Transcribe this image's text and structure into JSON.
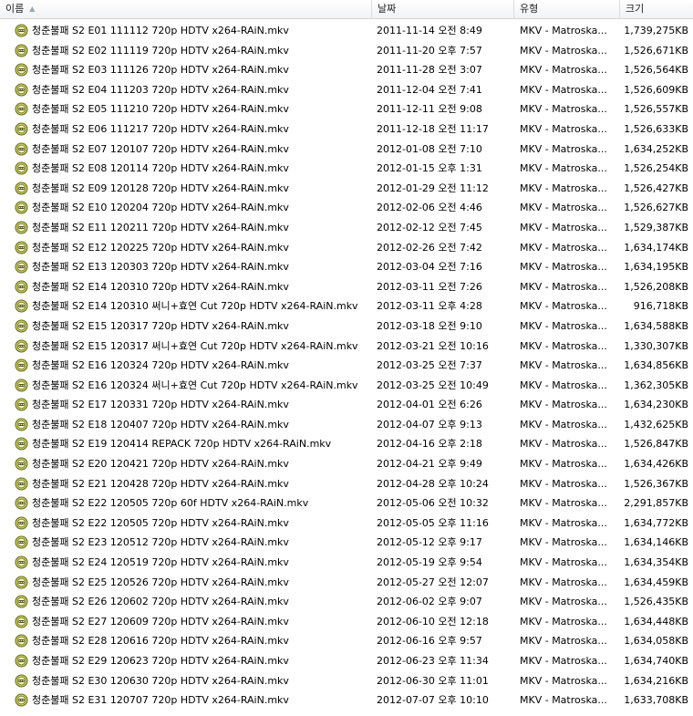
{
  "columns": {
    "name": "이름",
    "date": "날짜",
    "type": "유형",
    "size": "크기"
  },
  "sort": {
    "column": "name",
    "icon": "sort-ascending-icon"
  },
  "file_icon": "mkv-video-file-icon",
  "files": [
    {
      "name": "청춘불패 S2 E01 111112 720p HDTV x264-RAiN.mkv",
      "date": "2011-11-14 오전 8:49",
      "type": "MKV - Matroska...",
      "size": "1,739,275KB"
    },
    {
      "name": "청춘불패 S2 E02 111119 720p HDTV x264-RAiN.mkv",
      "date": "2011-11-20 오후 7:57",
      "type": "MKV - Matroska...",
      "size": "1,526,671KB"
    },
    {
      "name": "청춘불패 S2 E03 111126 720p HDTV x264-RAiN.mkv",
      "date": "2011-11-28 오전 3:07",
      "type": "MKV - Matroska...",
      "size": "1,526,564KB"
    },
    {
      "name": "청춘불패 S2 E04 111203 720p HDTV x264-RAiN.mkv",
      "date": "2011-12-04 오전 7:41",
      "type": "MKV - Matroska...",
      "size": "1,526,609KB"
    },
    {
      "name": "청춘불패 S2 E05 111210 720p HDTV x264-RAiN.mkv",
      "date": "2011-12-11 오전 9:08",
      "type": "MKV - Matroska...",
      "size": "1,526,557KB"
    },
    {
      "name": "청춘불패 S2 E06 111217 720p HDTV x264-RAiN.mkv",
      "date": "2011-12-18 오전 11:17",
      "type": "MKV - Matroska...",
      "size": "1,526,633KB"
    },
    {
      "name": "청춘불패 S2 E07 120107 720p HDTV x264-RAiN.mkv",
      "date": "2012-01-08 오전 7:10",
      "type": "MKV - Matroska...",
      "size": "1,634,252KB"
    },
    {
      "name": "청춘불패 S2 E08 120114 720p HDTV x264-RAiN.mkv",
      "date": "2012-01-15 오후 1:31",
      "type": "MKV - Matroska...",
      "size": "1,526,254KB"
    },
    {
      "name": "청춘불패 S2 E09 120128 720p HDTV x264-RAiN.mkv",
      "date": "2012-01-29 오전 11:12",
      "type": "MKV - Matroska...",
      "size": "1,526,427KB"
    },
    {
      "name": "청춘불패 S2 E10 120204 720p HDTV x264-RAiN.mkv",
      "date": "2012-02-06 오전 4:46",
      "type": "MKV - Matroska...",
      "size": "1,526,627KB"
    },
    {
      "name": "청춘불패 S2 E11 120211 720p HDTV x264-RAiN.mkv",
      "date": "2012-02-12 오전 7:45",
      "type": "MKV - Matroska...",
      "size": "1,529,387KB"
    },
    {
      "name": "청춘불패 S2 E12 120225 720p HDTV x264-RAiN.mkv",
      "date": "2012-02-26 오전 7:42",
      "type": "MKV - Matroska...",
      "size": "1,634,174KB"
    },
    {
      "name": "청춘불패 S2 E13 120303 720p HDTV x264-RAiN.mkv",
      "date": "2012-03-04 오전 7:16",
      "type": "MKV - Matroska...",
      "size": "1,634,195KB"
    },
    {
      "name": "청춘불패 S2 E14 120310 720p HDTV x264-RAiN.mkv",
      "date": "2012-03-11 오전 7:26",
      "type": "MKV - Matroska...",
      "size": "1,526,208KB"
    },
    {
      "name": "청춘불패 S2 E14 120310 써니+효연 Cut 720p HDTV x264-RAiN.mkv",
      "date": "2012-03-11 오후 4:28",
      "type": "MKV - Matroska...",
      "size": "916,718KB"
    },
    {
      "name": "청춘불패 S2 E15 120317 720p HDTV x264-RAiN.mkv",
      "date": "2012-03-18 오전 9:10",
      "type": "MKV - Matroska...",
      "size": "1,634,588KB"
    },
    {
      "name": "청춘불패 S2 E15 120317 써니+효연 Cut 720p HDTV x264-RAiN.mkv",
      "date": "2012-03-21 오전 10:16",
      "type": "MKV - Matroska...",
      "size": "1,330,307KB"
    },
    {
      "name": "청춘불패 S2 E16 120324 720p HDTV x264-RAiN.mkv",
      "date": "2012-03-25 오전 7:37",
      "type": "MKV - Matroska...",
      "size": "1,634,856KB"
    },
    {
      "name": "청춘불패 S2 E16 120324 써니+효연 Cut 720p HDTV x264-RAiN.mkv",
      "date": "2012-03-25 오전 10:49",
      "type": "MKV - Matroska...",
      "size": "1,362,305KB"
    },
    {
      "name": "청춘불패 S2 E17 120331 720p HDTV x264-RAiN.mkv",
      "date": "2012-04-01 오전 6:26",
      "type": "MKV - Matroska...",
      "size": "1,634,230KB"
    },
    {
      "name": "청춘불패 S2 E18 120407 720p HDTV x264-RAiN.mkv",
      "date": "2012-04-07 오후 9:13",
      "type": "MKV - Matroska...",
      "size": "1,432,625KB"
    },
    {
      "name": "청춘불패 S2 E19 120414 REPACK 720p HDTV x264-RAiN.mkv",
      "date": "2012-04-16 오후 2:18",
      "type": "MKV - Matroska...",
      "size": "1,526,847KB"
    },
    {
      "name": "청춘불패 S2 E20 120421 720p HDTV x264-RAiN.mkv",
      "date": "2012-04-21 오후 9:49",
      "type": "MKV - Matroska...",
      "size": "1,634,426KB"
    },
    {
      "name": "청춘불패 S2 E21 120428 720p HDTV x264-RAiN.mkv",
      "date": "2012-04-28 오후 10:24",
      "type": "MKV - Matroska...",
      "size": "1,526,367KB"
    },
    {
      "name": "청춘불패 S2 E22 120505 720p 60f HDTV x264-RAiN.mkv",
      "date": "2012-05-06 오전 10:32",
      "type": "MKV - Matroska...",
      "size": "2,291,857KB"
    },
    {
      "name": "청춘불패 S2 E22 120505 720p HDTV x264-RAiN.mkv",
      "date": "2012-05-05 오후 11:16",
      "type": "MKV - Matroska...",
      "size": "1,634,772KB"
    },
    {
      "name": "청춘불패 S2 E23 120512 720p HDTV x264-RAiN.mkv",
      "date": "2012-05-12 오후 9:17",
      "type": "MKV - Matroska...",
      "size": "1,634,146KB"
    },
    {
      "name": "청춘불패 S2 E24 120519 720p HDTV x264-RAiN.mkv",
      "date": "2012-05-19 오후 9:54",
      "type": "MKV - Matroska...",
      "size": "1,634,354KB"
    },
    {
      "name": "청춘불패 S2 E25 120526 720p HDTV x264-RAiN.mkv",
      "date": "2012-05-27 오전 12:07",
      "type": "MKV - Matroska...",
      "size": "1,634,459KB"
    },
    {
      "name": "청춘불패 S2 E26 120602 720p HDTV x264-RAiN.mkv",
      "date": "2012-06-02 오후 9:07",
      "type": "MKV - Matroska...",
      "size": "1,526,435KB"
    },
    {
      "name": "청춘불패 S2 E27 120609 720p HDTV x264-RAiN.mkv",
      "date": "2012-06-10 오전 12:18",
      "type": "MKV - Matroska...",
      "size": "1,634,448KB"
    },
    {
      "name": "청춘불패 S2 E28 120616 720p HDTV x264-RAiN.mkv",
      "date": "2012-06-16 오후 9:57",
      "type": "MKV - Matroska...",
      "size": "1,634,058KB"
    },
    {
      "name": "청춘불패 S2 E29 120623 720p HDTV x264-RAiN.mkv",
      "date": "2012-06-23 오후 11:34",
      "type": "MKV - Matroska...",
      "size": "1,634,740KB"
    },
    {
      "name": "청춘불패 S2 E30 120630 720p HDTV x264-RAiN.mkv",
      "date": "2012-06-30 오후 11:01",
      "type": "MKV - Matroska...",
      "size": "1,634,216KB"
    },
    {
      "name": "청춘불패 S2 E31 120707 720p HDTV x264-RAiN.mkv",
      "date": "2012-07-07 오후 10:10",
      "type": "MKV - Matroska...",
      "size": "1,633,708KB"
    }
  ]
}
